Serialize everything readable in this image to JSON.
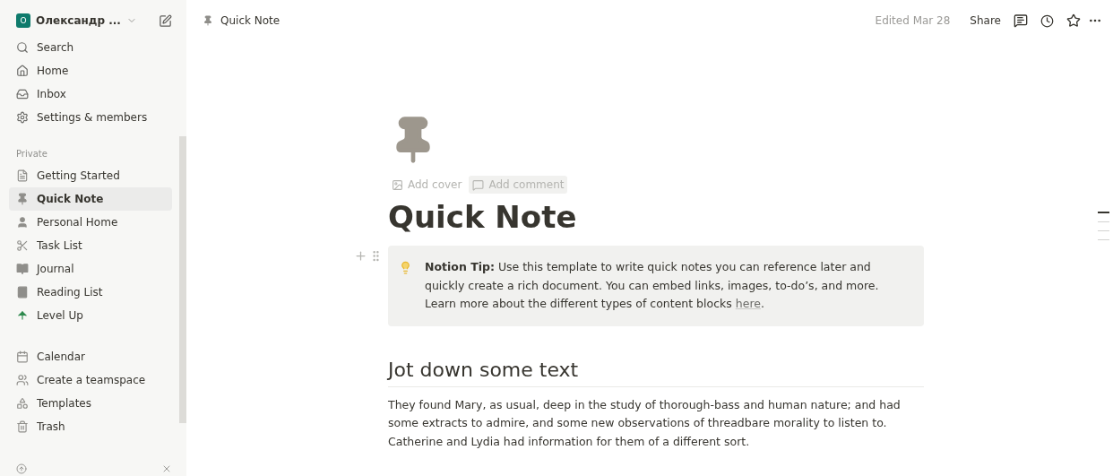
{
  "workspace": {
    "initial": "O",
    "name": "Олександр ..."
  },
  "nav": [
    {
      "label": "Search"
    },
    {
      "label": "Home"
    },
    {
      "label": "Inbox"
    },
    {
      "label": "Settings & members"
    }
  ],
  "private": {
    "heading": "Private",
    "pages": [
      {
        "label": "Getting Started",
        "selected": false
      },
      {
        "label": "Quick Note",
        "selected": true
      },
      {
        "label": "Personal Home",
        "selected": false
      },
      {
        "label": "Task List",
        "selected": false
      },
      {
        "label": "Journal",
        "selected": false
      },
      {
        "label": "Reading List",
        "selected": false
      },
      {
        "label": "Level Up",
        "selected": false
      }
    ]
  },
  "tools": [
    {
      "label": "Calendar"
    },
    {
      "label": "Create a teamspace"
    },
    {
      "label": "Templates"
    },
    {
      "label": "Trash"
    }
  ],
  "topbar": {
    "breadcrumb": "Quick Note",
    "edited": "Edited Mar 28",
    "share": "Share"
  },
  "page": {
    "add_cover": "Add cover",
    "add_comment": "Add comment",
    "title": "Quick Note",
    "callout": {
      "text": "**Notion Tip:** Use this template to write quick notes you can reference later and quickly create a rich document. You can embed links, images, to-do’s, and more. Learn more about the different types of content blocks ",
      "link": "here",
      "after": "."
    },
    "heading": "Jot down some text",
    "paragraph": "They found Mary, as usual, deep in the study of thorough-bass and human nature; and had some extracts to admire, and some new observations of threadbare morality to listen to. Catherine and Lydia had information for them of a different sort."
  },
  "outline": [
    {
      "selected": true
    },
    {
      "selected": false
    },
    {
      "selected": false
    },
    {
      "selected": false
    }
  ]
}
